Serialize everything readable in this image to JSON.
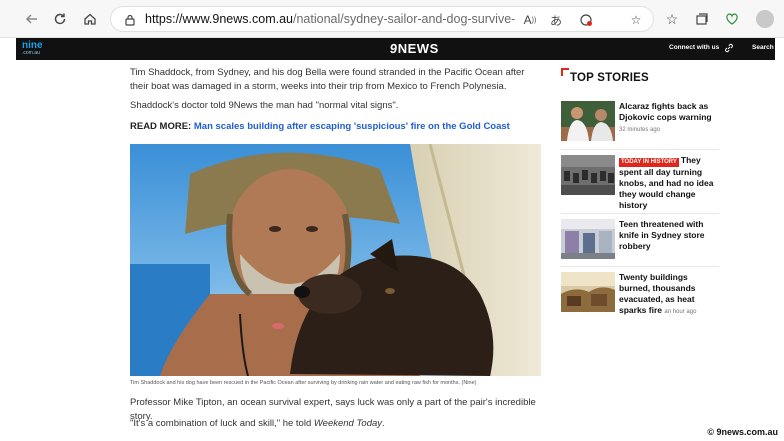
{
  "browser": {
    "url_host": "https://www.9news.com.au",
    "url_path": "/national/sydney-sailor-and-dog-survive-for-months-in-pa...",
    "icons": [
      "back-icon",
      "refresh-icon",
      "home-icon",
      "lock-icon",
      "read-aloud-icon",
      "translate-icon",
      "extension-icon",
      "favorite-icon",
      "favorites-bar-icon",
      "collections-icon",
      "browser-essentials-icon",
      "profile-icon"
    ]
  },
  "site": {
    "nine_logo": "nine",
    "nine_sub": ".com.au",
    "news_logo_mark": "9",
    "news_logo_word": "NEWS",
    "connect_label": "Connect with us",
    "search_label": "Search"
  },
  "article": {
    "para1": "Tim Shaddock, from Sydney, and his dog Bella were found stranded in the Pacific Ocean after their boat was damaged in a storm, weeks into their trip from Mexico to French Polynesia.",
    "para2": "Shaddock's doctor told 9News the man had \"normal vital signs\".",
    "read_more_label": "READ MORE:",
    "read_more_link": "Man scales building after escaping 'suspicious' fire on the Gold Coast",
    "caption": "Tim Shaddock and his dog have been rescued in the Pacific Ocean after surviving by drinking rain water and eating raw fish for months. (Nine)",
    "para3": "Professor Mike Tipton, an ocean survival expert, says luck was only a part of the pair's incredible story.",
    "para4_prefix": "\"It's a combination of luck and skill,\" he told ",
    "para4_italic": "Weekend Today",
    "para4_suffix": "."
  },
  "sidebar": {
    "title": "TOP STORIES",
    "stories": [
      {
        "title": "Alcaraz fights back as Djokovic cops warning",
        "time": "32 minutes ago",
        "badge": ""
      },
      {
        "title": "They spent all day turning knobs, and had no idea they would change history",
        "time": "",
        "badge": "TODAY IN HISTORY"
      },
      {
        "title": "Teen threatened with knife in Sydney store robbery",
        "time": "",
        "badge": ""
      },
      {
        "title": "Twenty buildings burned, thousands evacuated, as heat sparks fire",
        "time": "an hour ago",
        "badge": ""
      }
    ]
  },
  "credit": "© 9news.com.au",
  "colors": {
    "accent_red": "#e0261b",
    "link_blue": "#1f5fd1",
    "header_bg": "#111111"
  }
}
